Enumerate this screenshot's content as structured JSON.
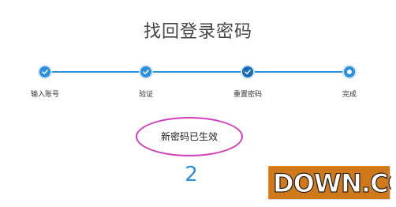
{
  "header": {
    "title": "找回登录密码"
  },
  "steps": [
    {
      "label": "输入账号",
      "state": "done"
    },
    {
      "label": "验证",
      "state": "done"
    },
    {
      "label": "重置密码",
      "state": "done"
    },
    {
      "label": "完成",
      "state": "current"
    }
  ],
  "status": {
    "message": "新密码已生效"
  },
  "countdown": {
    "value": "2"
  },
  "watermark": {
    "text": "DOWN.CC"
  },
  "colors": {
    "accent": "#2a8fdc",
    "highlight_ring": "#d33cbc",
    "watermark_orange": "#f08a1c"
  }
}
